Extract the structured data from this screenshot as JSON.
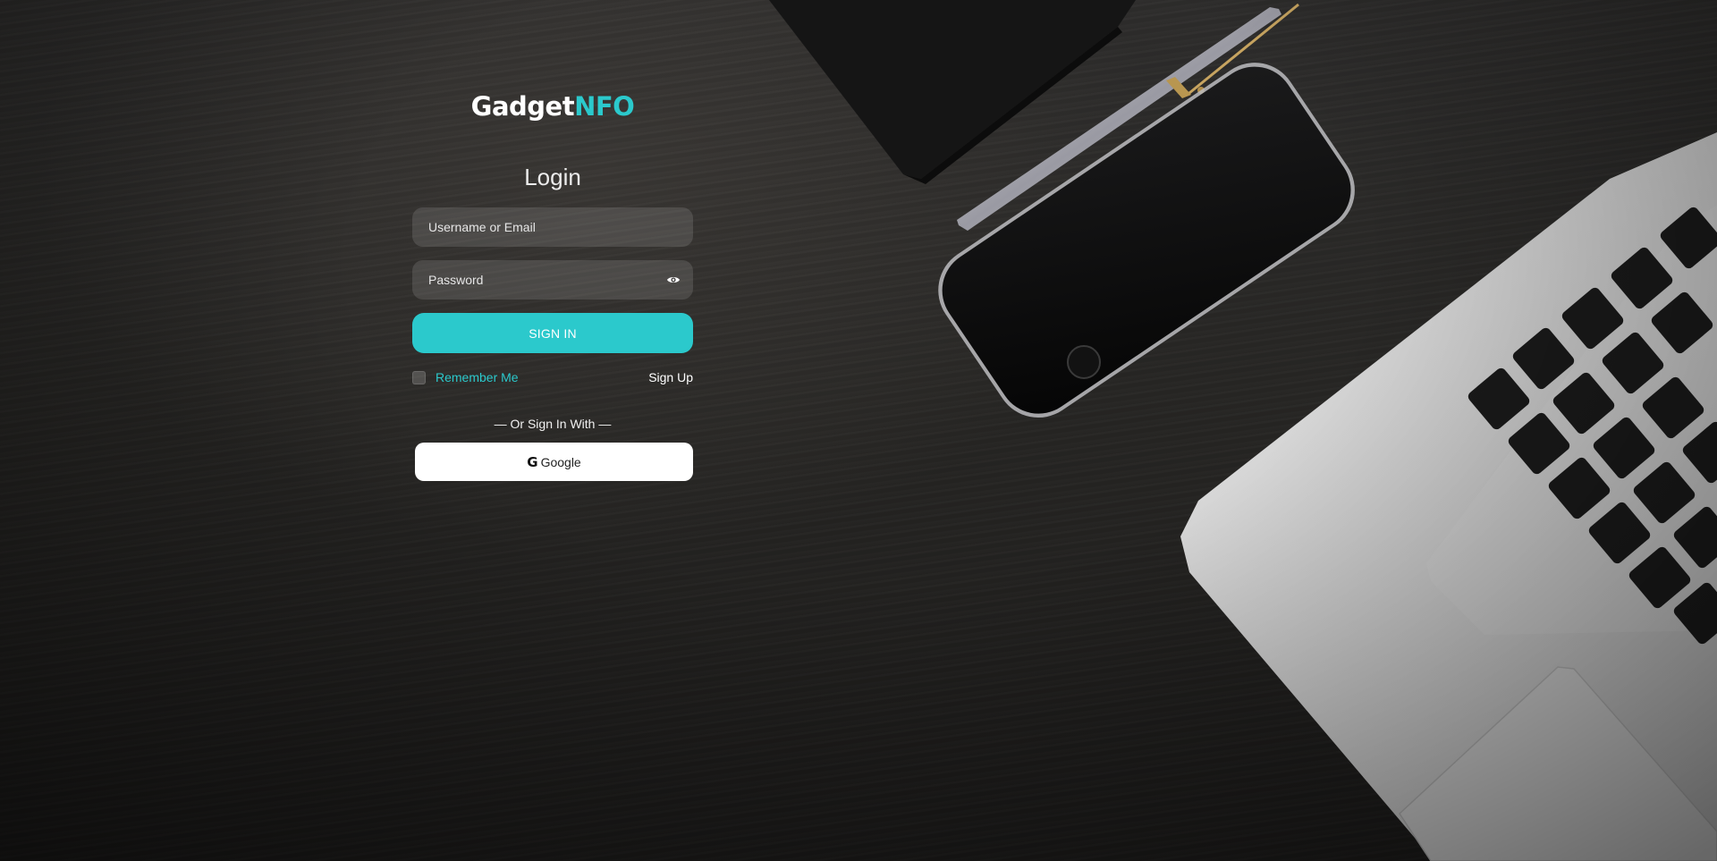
{
  "brand": {
    "name_part1": "Gadget",
    "name_part2": "NFO"
  },
  "login": {
    "title": "Login",
    "username_placeholder": "Username or Email",
    "password_placeholder": "Password",
    "password_toggle_icon": "eye-icon",
    "signin_label": "SIGN IN",
    "remember_label": "Remember Me",
    "remember_checked": false,
    "signup_label": "Sign Up",
    "divider_text": "— Or Sign In With —",
    "google_icon": "G",
    "google_label": "Google"
  },
  "colors": {
    "accent": "#2bc9cc",
    "background": "#272624",
    "field_bg": "rgba(255,255,255,0.12)",
    "google_button_bg": "#ffffff"
  }
}
